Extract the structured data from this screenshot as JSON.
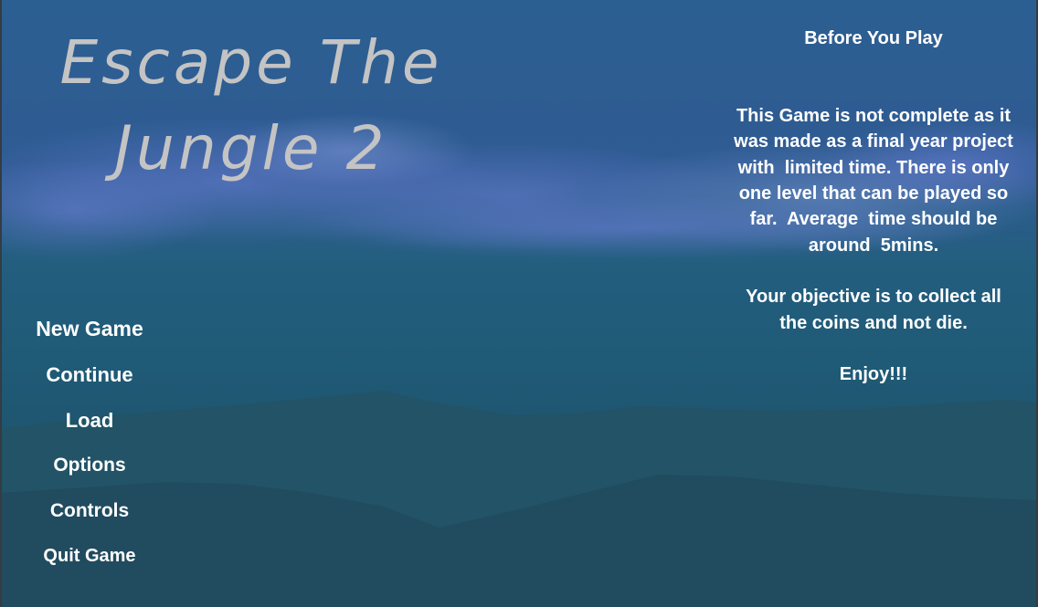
{
  "game": {
    "title": "Escape The\nJungle 2"
  },
  "main_menu": {
    "items": [
      {
        "label": "New Game"
      },
      {
        "label": "Continue"
      },
      {
        "label": "Load"
      },
      {
        "label": "Options"
      },
      {
        "label": "Controls"
      },
      {
        "label": "Quit Game"
      }
    ]
  },
  "info_panel": {
    "heading": "Before You Play",
    "body": "This Game is not complete as it\nwas made as a final year project\nwith  limited time. There is only\none level that can be played so\nfar.  Average  time should be\naround  5mins.\n\nYour objective is to collect all\nthe coins and not die.\n\nEnjoy!!!"
  },
  "colors": {
    "sky_top": "#2c5f90",
    "sky_mid": "#3a5d9c",
    "horizon": "#1f5a78",
    "ground": "#214c61",
    "mountain": "#2a5670",
    "text": "#ffffff",
    "title": "#c4c4c4"
  }
}
